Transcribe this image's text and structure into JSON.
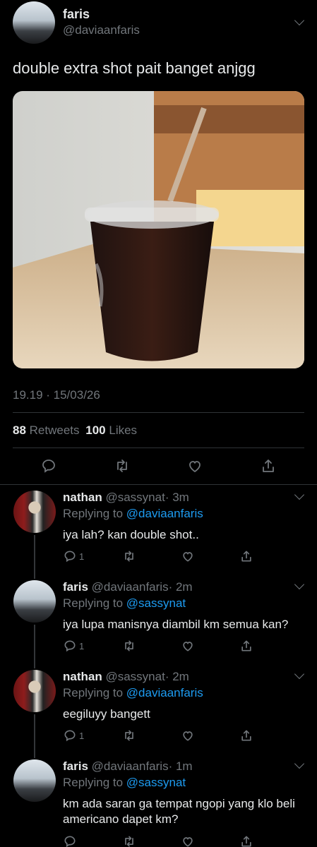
{
  "main_tweet": {
    "display_name": "faris",
    "handle": "@daviaanfaris",
    "text": "double extra shot pait banget anjgg",
    "timestamp": "19.19 · 15/03/26",
    "retweets_count": "88",
    "retweets_label": "Retweets",
    "likes_count": "100",
    "likes_label": "Likes"
  },
  "replies": [
    {
      "display_name": "nathan",
      "handle": "@sassynat",
      "time": "· 3m",
      "replying_prefix": "Replying to",
      "replying_to": "@daviaanfaris",
      "text": "iya lah? kan double shot..",
      "reply_count": "1"
    },
    {
      "display_name": "faris",
      "handle": "@daviaanfaris",
      "time": "· 2m",
      "replying_prefix": "Replying to",
      "replying_to": "@sassynat",
      "text": "iya lupa manisnya diambil km semua kan?",
      "reply_count": "1"
    },
    {
      "display_name": "nathan",
      "handle": "@sassynat",
      "time": "· 2m",
      "replying_prefix": "Replying to",
      "replying_to": "@daviaanfaris",
      "text": "eegiluyy bangett",
      "reply_count": "1"
    },
    {
      "display_name": "faris",
      "handle": "@daviaanfaris",
      "time": "· 1m",
      "replying_prefix": "Replying to",
      "replying_to": "@sassynat",
      "text": "km ada saran ga tempat ngopi yang klo beli americano dapet km?",
      "reply_count": ""
    }
  ],
  "colors": {
    "background": "#000000",
    "text": "#e7e9ea",
    "secondary": "#71767b",
    "link": "#1d9bf0",
    "divider": "#2f3336"
  },
  "icons": [
    "reply-icon",
    "retweet-icon",
    "like-icon",
    "share-icon",
    "chevron-down-icon"
  ]
}
